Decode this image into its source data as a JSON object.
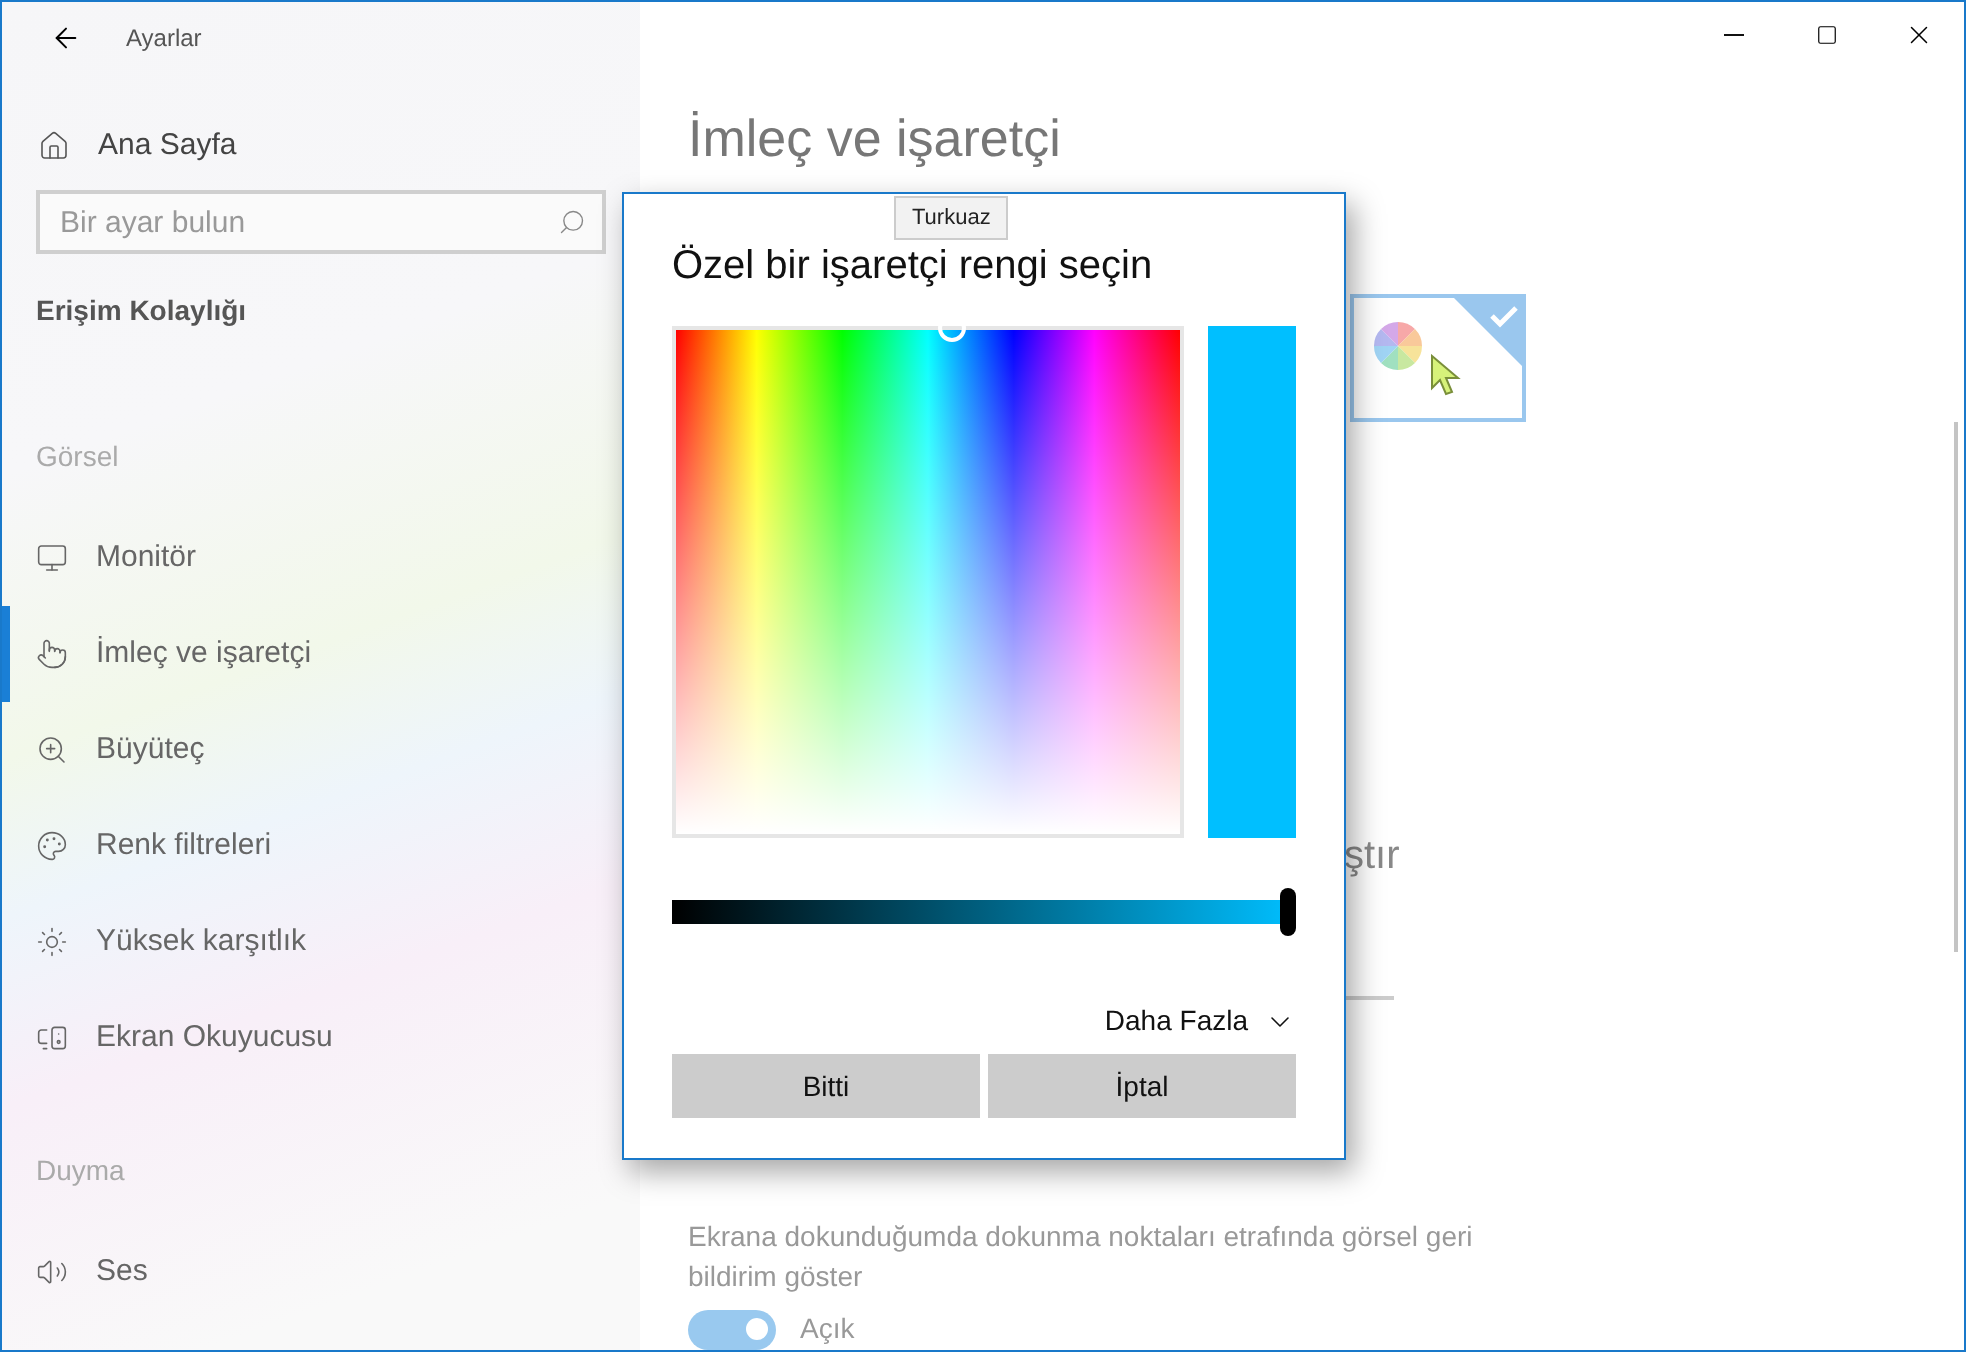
{
  "window": {
    "title": "Ayarlar"
  },
  "sidebar": {
    "home": "Ana Sayfa",
    "search": {
      "placeholder": "Bir ayar bulun"
    },
    "category": "Erişim Kolaylığı",
    "sections": [
      {
        "header": "Görsel",
        "items": [
          {
            "label": "Monitör",
            "selected": false
          },
          {
            "label": "İmleç ve işaretçi",
            "selected": true
          },
          {
            "label": "Büyüteç",
            "selected": false
          },
          {
            "label": "Renk filtreleri",
            "selected": false
          },
          {
            "label": "Yüksek karşıtlık",
            "selected": false
          },
          {
            "label": "Ekran Okuyucusu",
            "selected": false
          }
        ]
      },
      {
        "header": "Duyma",
        "items": [
          {
            "label": "Ses",
            "selected": false
          }
        ]
      }
    ]
  },
  "page": {
    "title": "İmleç ve işaretçi",
    "color_options": [
      {
        "kind": "custom",
        "selected": true
      }
    ],
    "partial_heading": "ştır",
    "touch": {
      "description": "Ekrana dokunduğumda dokunma noktaları etrafında görsel geri bildirim göster",
      "toggle": {
        "on": true,
        "label": "Açık"
      }
    }
  },
  "dialog": {
    "title": "Özel bir işaretçi rengi seçin",
    "tooltip": "Turkuaz",
    "color": "#00bfff",
    "brightness": {
      "level": 1
    },
    "more": "Daha Fazla",
    "buttons": [
      "Bitti",
      "İptal"
    ]
  }
}
